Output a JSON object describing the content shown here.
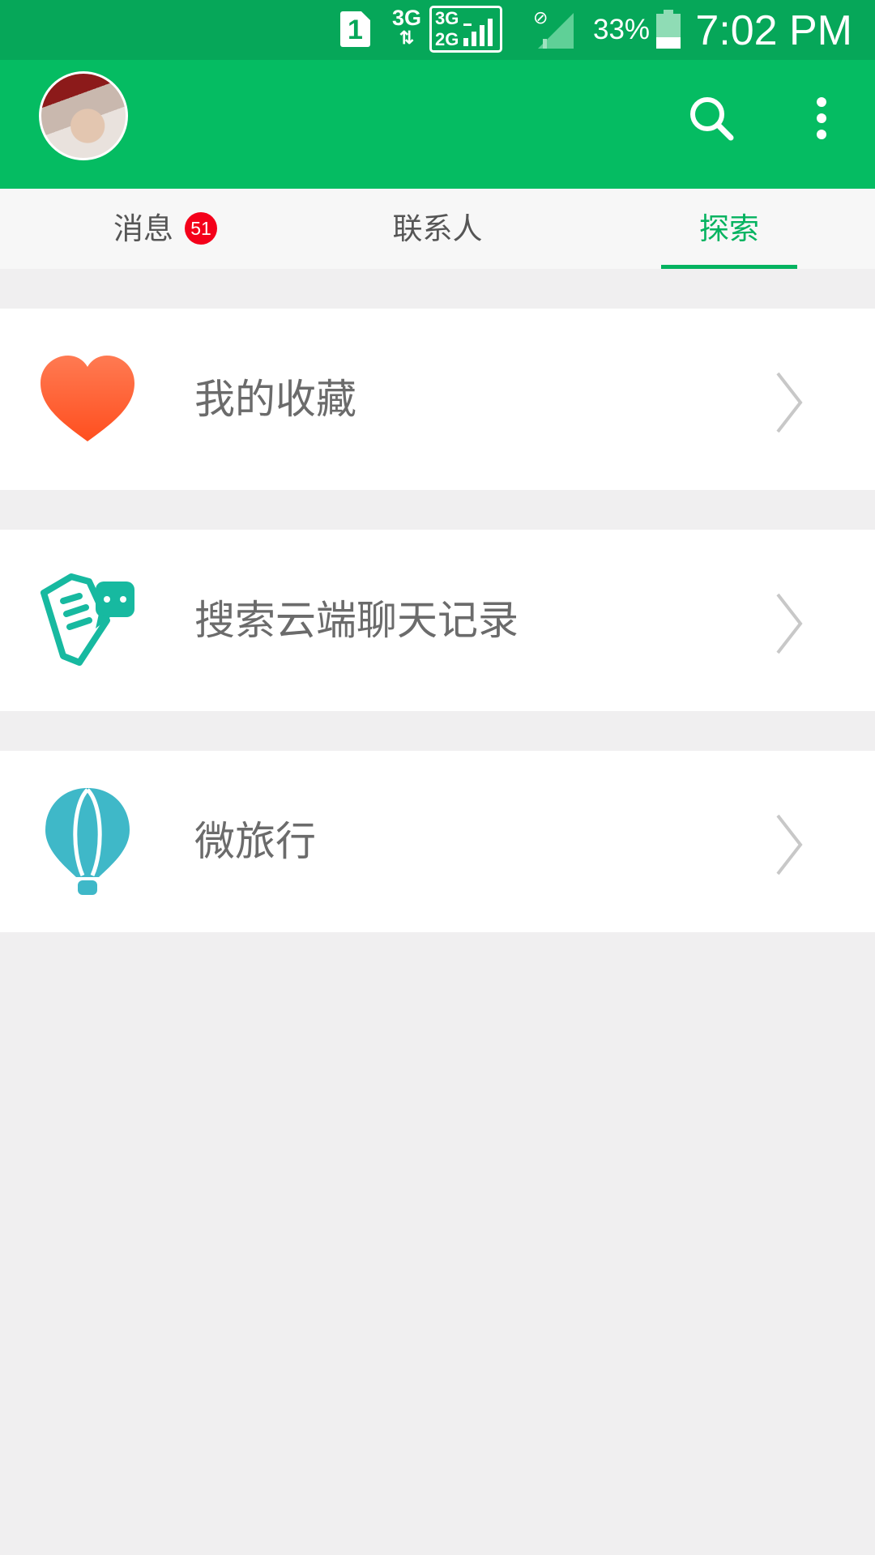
{
  "status_bar": {
    "sim_slot": "1",
    "network_type": "3G",
    "network_arrows": "⇅",
    "dual_top": "3G",
    "dual_bottom": "2G",
    "battery_percent": "33%",
    "time": "7:02 PM",
    "battery_level": 0.33
  },
  "app_bar": {
    "avatar": "user-avatar",
    "search_icon": "search-icon",
    "more_icon": "more-vert-icon"
  },
  "tabs": [
    {
      "label": "消息",
      "badge": "51",
      "active": false
    },
    {
      "label": "联系人",
      "active": false
    },
    {
      "label": "探索",
      "active": true
    }
  ],
  "explore_items": [
    {
      "label": "我的收藏",
      "icon": "heart-icon"
    },
    {
      "label": "搜索云端聊天记录",
      "icon": "chat-record-icon"
    },
    {
      "label": "微旅行",
      "icon": "hot-air-balloon-icon"
    }
  ],
  "colors": {
    "status_bar": "#06a759",
    "app_bar": "#05bc62",
    "accent": "#05b360",
    "badge": "#f4001a",
    "heart": "#ff5a2e",
    "chat_icon": "#17b9a0",
    "balloon": "#3fb8c8"
  }
}
